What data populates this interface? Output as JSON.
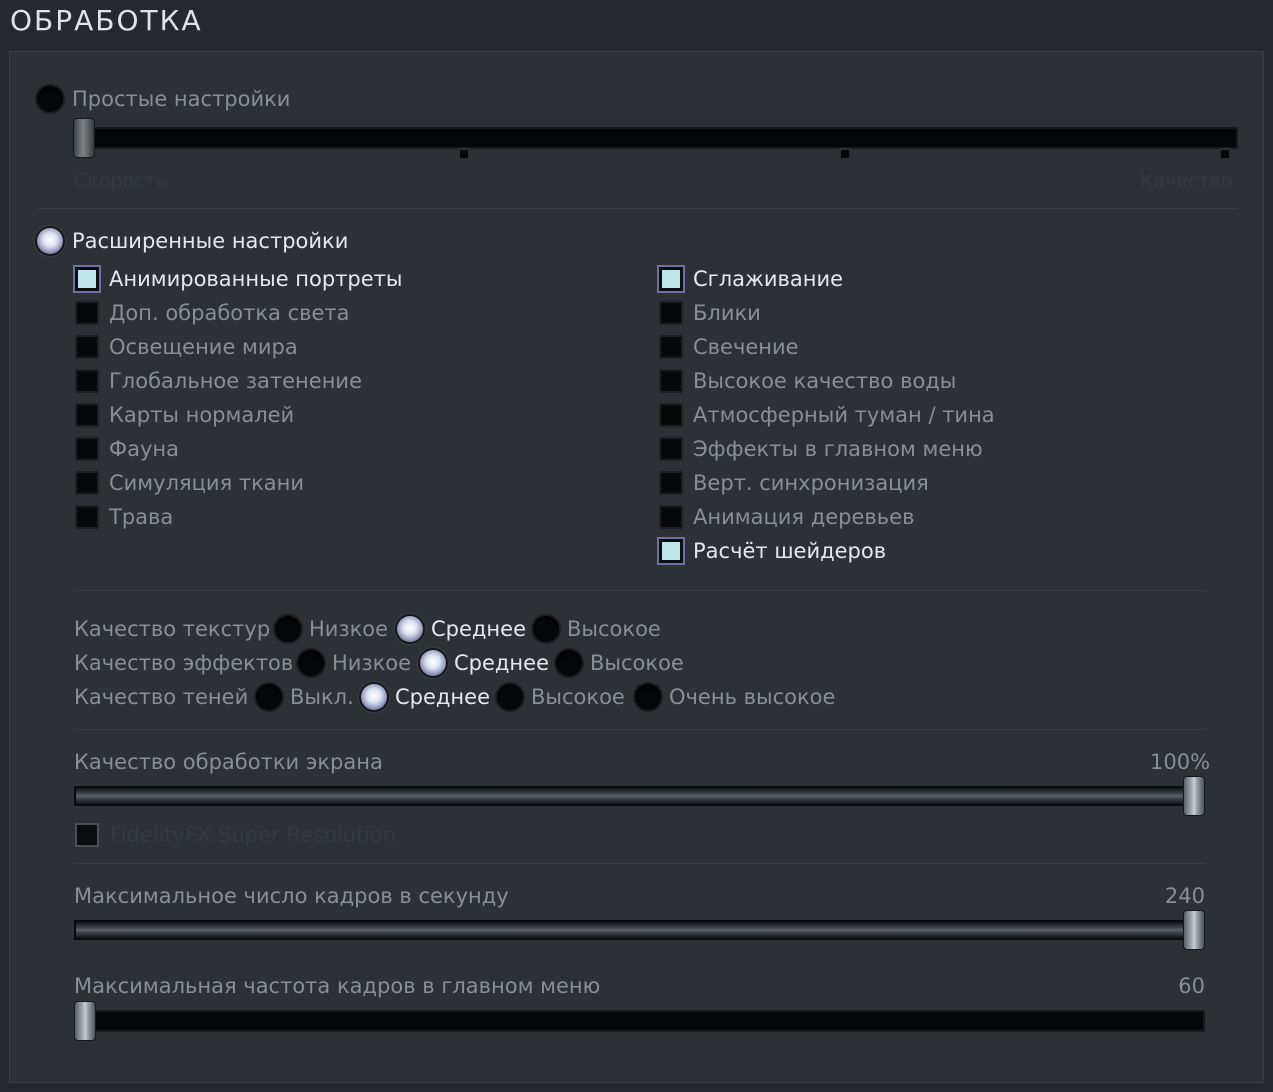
{
  "page": {
    "title": "ОБРАБОТКА"
  },
  "simple": {
    "label": "Простые настройки",
    "selected": false,
    "slider_value": 0,
    "left_label": "Скорость",
    "right_label": "Качество"
  },
  "advanced": {
    "label": "Расширенные настройки",
    "selected": true,
    "left_checks": [
      {
        "label": "Анимированные портреты",
        "checked": true
      },
      {
        "label": "Доп. обработка света",
        "checked": false
      },
      {
        "label": "Освещение мира",
        "checked": false
      },
      {
        "label": "Глобальное затенение",
        "checked": false
      },
      {
        "label": "Карты нормалей",
        "checked": false
      },
      {
        "label": "Фауна",
        "checked": false
      },
      {
        "label": "Симуляция ткани",
        "checked": false
      },
      {
        "label": "Трава",
        "checked": false
      }
    ],
    "right_checks": [
      {
        "label": "Сглаживание",
        "checked": true
      },
      {
        "label": "Блики",
        "checked": false
      },
      {
        "label": "Свечение",
        "checked": false
      },
      {
        "label": "Высокое качество воды",
        "checked": false
      },
      {
        "label": "Атмосферный туман / тина",
        "checked": false
      },
      {
        "label": "Эффекты в главном меню",
        "checked": false
      },
      {
        "label": "Верт. синхронизация",
        "checked": false
      },
      {
        "label": "Анимация деревьев",
        "checked": false
      },
      {
        "label": "Расчёт шейдеров",
        "checked": true
      }
    ]
  },
  "quality": {
    "texture": {
      "label": "Качество текстур",
      "options": [
        "Низкое",
        "Среднее",
        "Высокое"
      ],
      "selected": "Среднее"
    },
    "effects": {
      "label": "Качество эффектов",
      "options": [
        "Низкое",
        "Среднее",
        "Высокое"
      ],
      "selected": "Среднее"
    },
    "shadows": {
      "label": "Качество теней",
      "options": [
        "Выкл.",
        "Среднее",
        "Высокое",
        "Очень высокое"
      ],
      "selected": "Среднее"
    }
  },
  "screen": {
    "label": "Качество обработки экрана",
    "value_text": "100%",
    "value_fraction": 1.0,
    "fsr_label": "FidelityFX Super Resolution",
    "fsr_checked": false
  },
  "fps": {
    "label": "Максимальное число кадров в секунду",
    "value_text": "240",
    "value_fraction": 1.0
  },
  "menu_fps": {
    "label": "Максимальная частота кадров в главном меню",
    "value_text": "60",
    "value_fraction": 0.0
  }
}
